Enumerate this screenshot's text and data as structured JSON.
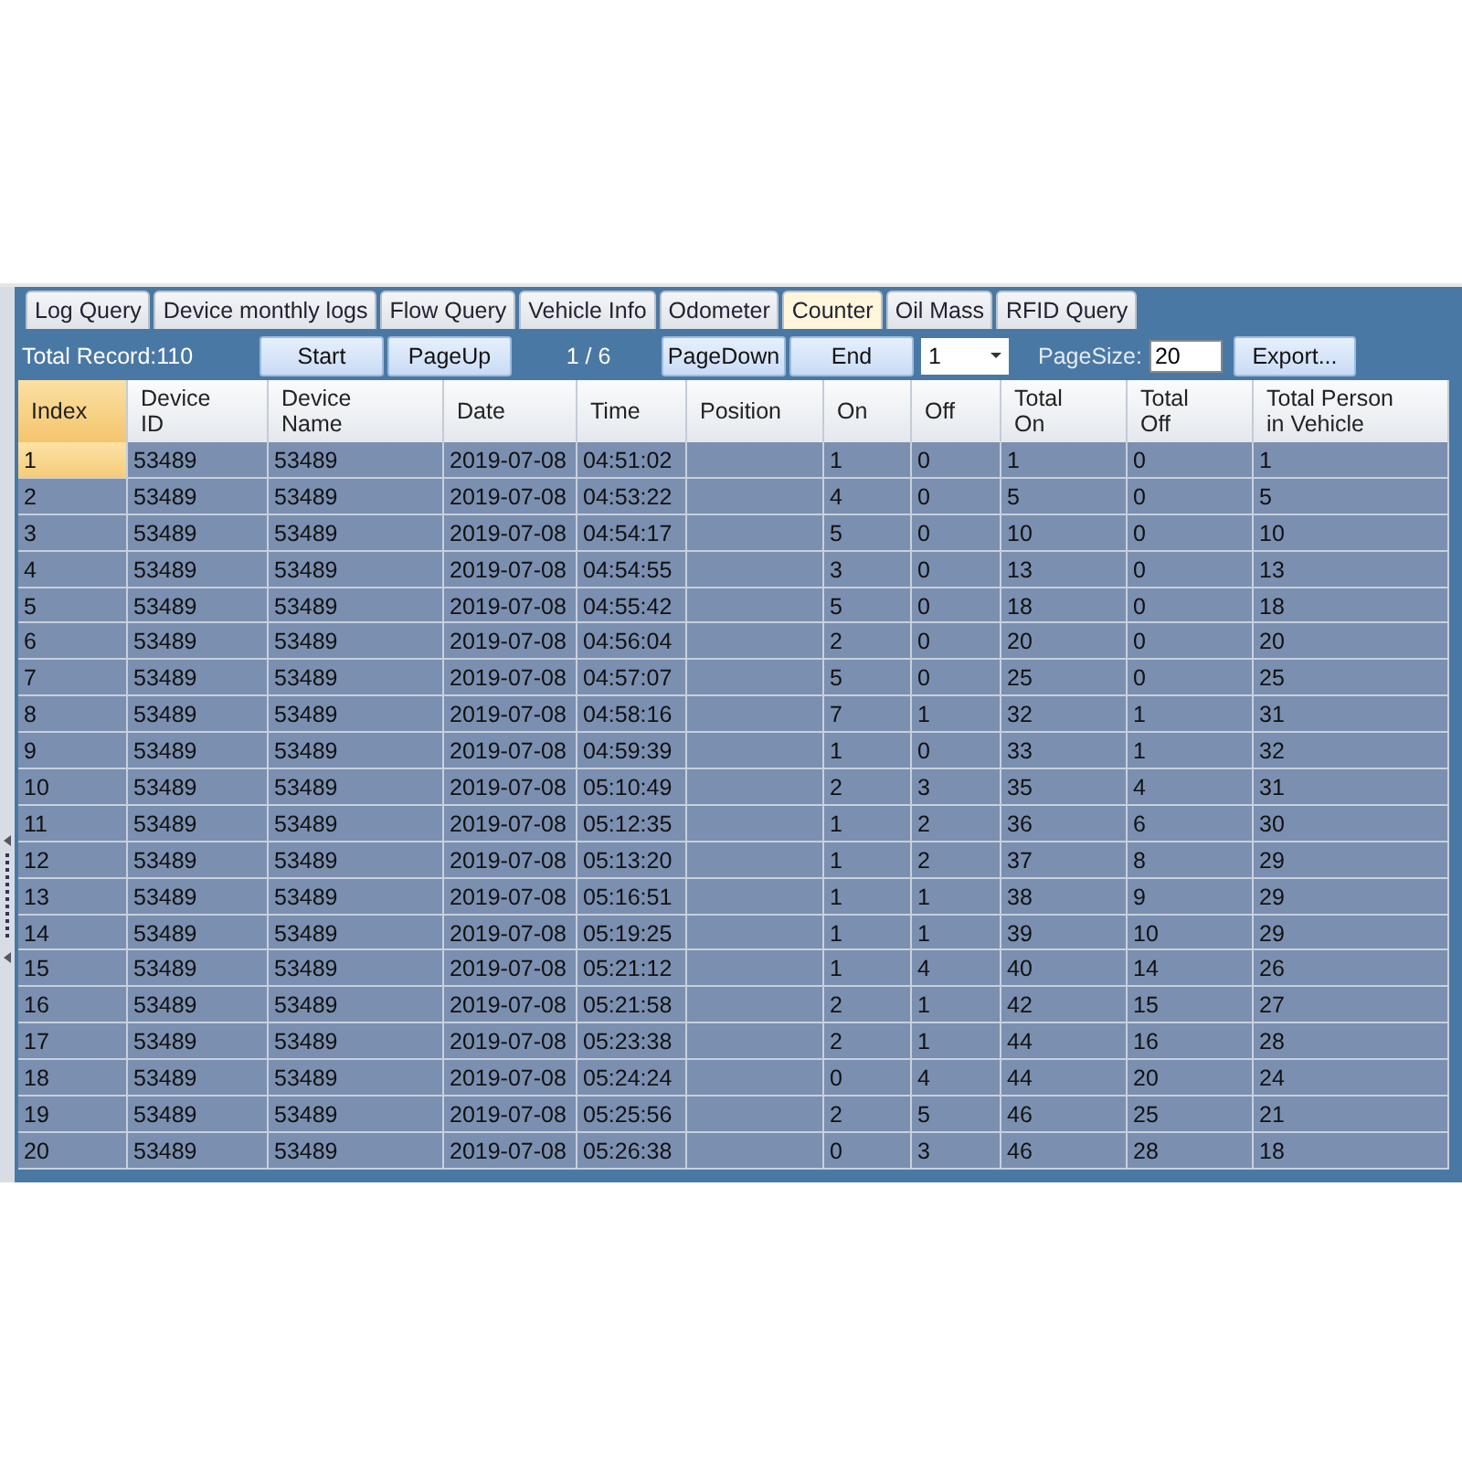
{
  "tabs": [
    {
      "label": "Log Query",
      "selected": false
    },
    {
      "label": "Device monthly logs",
      "selected": false
    },
    {
      "label": "Flow Query",
      "selected": false
    },
    {
      "label": "Vehicle Info",
      "selected": false
    },
    {
      "label": "Odometer",
      "selected": false
    },
    {
      "label": "Counter",
      "selected": true
    },
    {
      "label": "Oil Mass",
      "selected": false
    },
    {
      "label": "RFID Query",
      "selected": false
    }
  ],
  "toolbar": {
    "total_record": "Total Record:110",
    "start_button": "Start",
    "page_up_button": "PageUp",
    "page_indicator": "1 / 6",
    "page_down_button": "PageDown",
    "end_button": "End",
    "page_select": "1",
    "page_size_label": "PageSize:",
    "page_size_value": "20",
    "export_button": "Export..."
  },
  "table": {
    "columns": [
      {
        "lines": [
          "Index"
        ]
      },
      {
        "lines": [
          "Device",
          "ID"
        ]
      },
      {
        "lines": [
          "Device",
          "Name"
        ]
      },
      {
        "lines": [
          "Date"
        ]
      },
      {
        "lines": [
          "Time"
        ]
      },
      {
        "lines": [
          "Position"
        ]
      },
      {
        "lines": [
          "On"
        ]
      },
      {
        "lines": [
          "Off"
        ]
      },
      {
        "lines": [
          "Total",
          "On"
        ]
      },
      {
        "lines": [
          "Total",
          "Off"
        ]
      },
      {
        "lines": [
          "Total Person",
          "in Vehicle"
        ]
      }
    ],
    "rows": [
      {
        "selected": true,
        "index": "1",
        "device_id": "53489",
        "device_name": "53489",
        "date": "2019-07-08",
        "time": "04:51:02",
        "on": "1",
        "off": "0",
        "total_on": "1",
        "total_off": "0",
        "total_person": "1"
      },
      {
        "selected": false,
        "index": "2",
        "device_id": "53489",
        "device_name": "53489",
        "date": "2019-07-08",
        "time": "04:53:22",
        "on": "4",
        "off": "0",
        "total_on": "5",
        "total_off": "0",
        "total_person": "5"
      },
      {
        "selected": false,
        "index": "3",
        "device_id": "53489",
        "device_name": "53489",
        "date": "2019-07-08",
        "time": "04:54:17",
        "on": "5",
        "off": "0",
        "total_on": "10",
        "total_off": "0",
        "total_person": "10"
      },
      {
        "selected": false,
        "index": "4",
        "device_id": "53489",
        "device_name": "53489",
        "date": "2019-07-08",
        "time": "04:54:55",
        "on": "3",
        "off": "0",
        "total_on": "13",
        "total_off": "0",
        "total_person": "13"
      },
      {
        "selected": false,
        "index": "5",
        "device_id": "53489",
        "device_name": "53489",
        "date": "2019-07-08",
        "time": "04:55:42",
        "on": "5",
        "off": "0",
        "total_on": "18",
        "total_off": "0",
        "total_person": "18"
      },
      {
        "selected": false,
        "index": "6",
        "device_id": "53489",
        "device_name": "53489",
        "date": "2019-07-08",
        "time": "04:56:04",
        "on": "2",
        "off": "0",
        "total_on": "20",
        "total_off": "0",
        "total_person": "20"
      },
      {
        "selected": false,
        "index": "7",
        "device_id": "53489",
        "device_name": "53489",
        "date": "2019-07-08",
        "time": "04:57:07",
        "on": "5",
        "off": "0",
        "total_on": "25",
        "total_off": "0",
        "total_person": "25"
      },
      {
        "selected": false,
        "index": "8",
        "device_id": "53489",
        "device_name": "53489",
        "date": "2019-07-08",
        "time": "04:58:16",
        "on": "7",
        "off": "1",
        "total_on": "32",
        "total_off": "1",
        "total_person": "31"
      },
      {
        "selected": false,
        "index": "9",
        "device_id": "53489",
        "device_name": "53489",
        "date": "2019-07-08",
        "time": "04:59:39",
        "on": "1",
        "off": "0",
        "total_on": "33",
        "total_off": "1",
        "total_person": "32"
      },
      {
        "selected": false,
        "index": "10",
        "device_id": "53489",
        "device_name": "53489",
        "date": "2019-07-08",
        "time": "05:10:49",
        "on": "2",
        "off": "3",
        "total_on": "35",
        "total_off": "4",
        "total_person": "31"
      },
      {
        "selected": false,
        "index": "11",
        "device_id": "53489",
        "device_name": "53489",
        "date": "2019-07-08",
        "time": "05:12:35",
        "on": "1",
        "off": "2",
        "total_on": "36",
        "total_off": "6",
        "total_person": "30"
      },
      {
        "selected": false,
        "index": "12",
        "device_id": "53489",
        "device_name": "53489",
        "date": "2019-07-08",
        "time": "05:13:20",
        "on": "1",
        "off": "2",
        "total_on": "37",
        "total_off": "8",
        "total_person": "29"
      },
      {
        "selected": false,
        "index": "13",
        "device_id": "53489",
        "device_name": "53489",
        "date": "2019-07-08",
        "time": "05:16:51",
        "on": "1",
        "off": "1",
        "total_on": "38",
        "total_off": "9",
        "total_person": "29"
      },
      {
        "selected": false,
        "index": "14",
        "device_id": "53489",
        "device_name": "53489",
        "date": "2019-07-08",
        "time": "05:19:25",
        "on": "1",
        "off": "1",
        "total_on": "39",
        "total_off": "10",
        "total_person": "29"
      },
      {
        "selected": false,
        "index": "15",
        "device_id": "53489",
        "device_name": "53489",
        "date": "2019-07-08",
        "time": "05:21:12",
        "on": "1",
        "off": "4",
        "total_on": "40",
        "total_off": "14",
        "total_person": "26"
      },
      {
        "selected": false,
        "index": "16",
        "device_id": "53489",
        "device_name": "53489",
        "date": "2019-07-08",
        "time": "05:21:58",
        "on": "2",
        "off": "1",
        "total_on": "42",
        "total_off": "15",
        "total_person": "27"
      },
      {
        "selected": false,
        "index": "17",
        "device_id": "53489",
        "device_name": "53489",
        "date": "2019-07-08",
        "time": "05:23:38",
        "on": "2",
        "off": "1",
        "total_on": "44",
        "total_off": "16",
        "total_person": "28"
      },
      {
        "selected": false,
        "index": "18",
        "device_id": "53489",
        "device_name": "53489",
        "date": "2019-07-08",
        "time": "05:24:24",
        "on": "0",
        "off": "4",
        "total_on": "44",
        "total_off": "20",
        "total_person": "24"
      },
      {
        "selected": false,
        "index": "19",
        "device_id": "53489",
        "device_name": "53489",
        "date": "2019-07-08",
        "time": "05:25:56",
        "on": "2",
        "off": "5",
        "total_on": "46",
        "total_off": "25",
        "total_person": "21"
      },
      {
        "selected": false,
        "index": "20",
        "device_id": "53489",
        "device_name": "53489",
        "date": "2019-07-08",
        "time": "05:26:38",
        "on": "0",
        "off": "3",
        "total_on": "46",
        "total_off": "28",
        "total_person": "18"
      }
    ]
  }
}
